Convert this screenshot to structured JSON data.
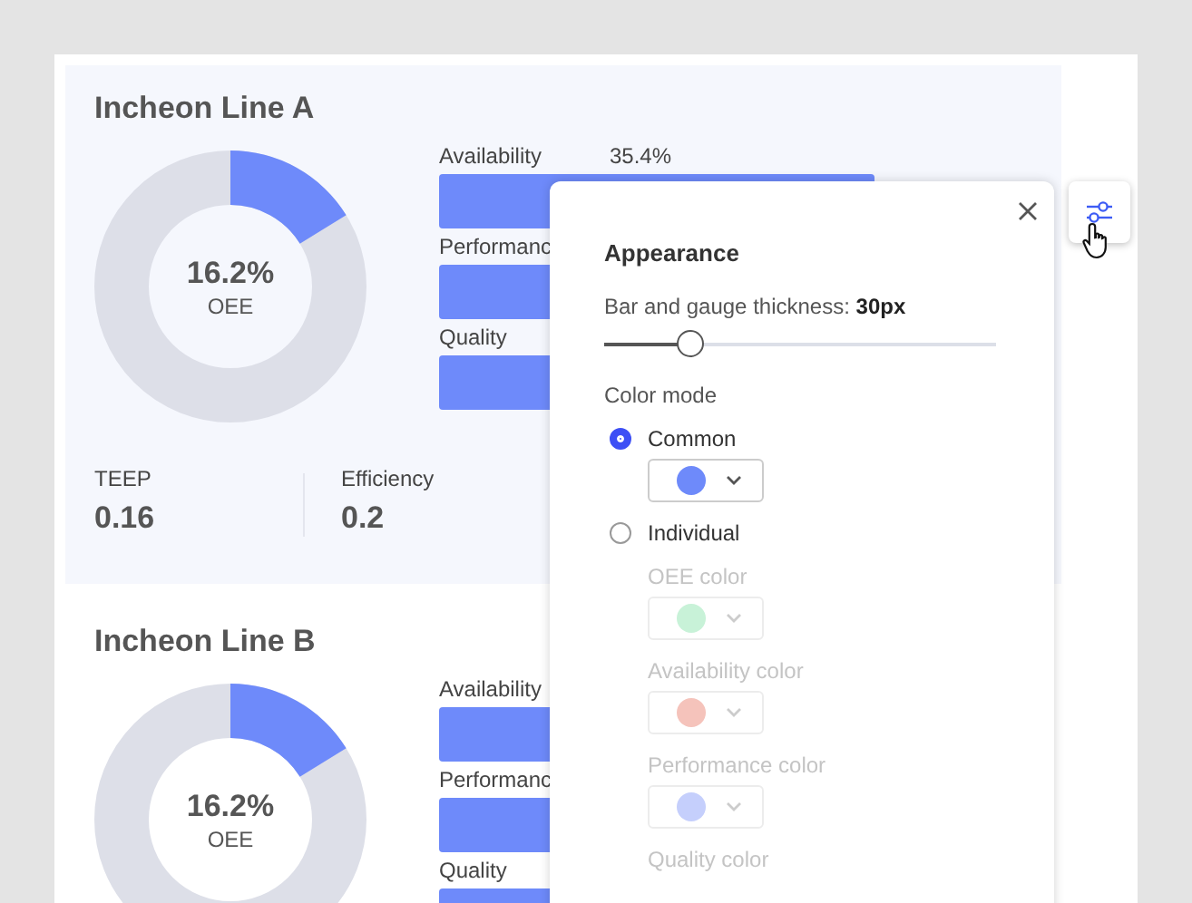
{
  "cards": [
    {
      "title": "Incheon Line A",
      "oee": {
        "value": "16.2%",
        "label": "OEE"
      },
      "metrics": [
        {
          "label": "Availability",
          "value": "35.4%"
        },
        {
          "label": "Performanc"
        },
        {
          "label": "Quality"
        }
      ],
      "stats": [
        {
          "label": "TEEP",
          "value": "0.16"
        },
        {
          "label": "Efficiency",
          "value": "0.2"
        }
      ]
    },
    {
      "title": "Incheon Line B",
      "oee": {
        "value": "16.2%",
        "label": "OEE"
      },
      "metrics": [
        {
          "label": "Availability"
        },
        {
          "label": "Performanc"
        },
        {
          "label": "Quality"
        }
      ]
    }
  ],
  "settings_button": {
    "active": true
  },
  "popover": {
    "heading": "Appearance",
    "thickness_label": "Bar and gauge thickness: **30px**",
    "thickness": {
      "level": 0.22
    },
    "color_mode_label": "Color mode",
    "options": [
      {
        "label": "Common",
        "selected": true
      },
      {
        "label": "Individual",
        "selected": false
      }
    ],
    "common": {
      "color": "#6e8afa"
    },
    "individual": {
      "disabled": true,
      "colors": [
        {
          "label": "OEE color",
          "color": "#c8f2d8"
        },
        {
          "label": "Availability color",
          "color": "#f5c3bb"
        },
        {
          "label": "Performance color",
          "color": "#c5cffc"
        },
        {
          "label": "Quality color"
        }
      ]
    }
  }
}
